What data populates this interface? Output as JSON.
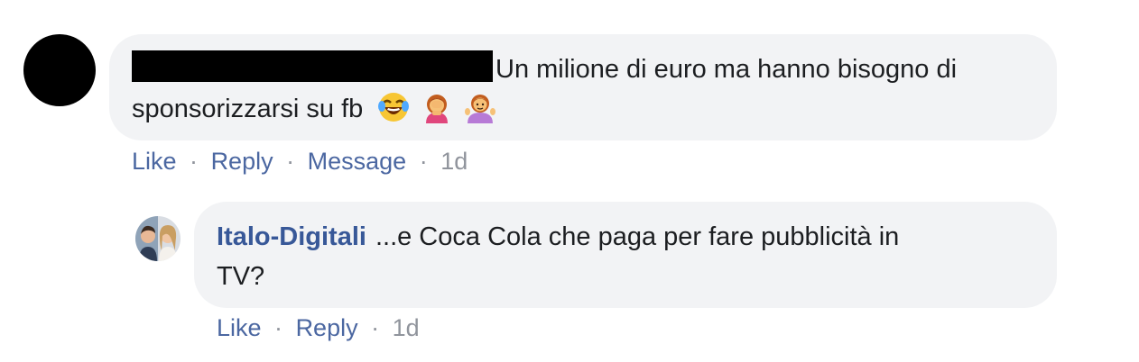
{
  "comment": {
    "text_line1": "Un milione di euro ma hanno bisogno di",
    "text_line2": "sponsorizzarsi su fb",
    "emojis": [
      "laughing-tears-emoji",
      "woman-facepalming-emoji",
      "woman-shrugging-emoji"
    ],
    "actions": {
      "like": "Like",
      "reply": "Reply",
      "message": "Message",
      "separator": "·",
      "time": "1d"
    }
  },
  "reply": {
    "author": "Italo-Digitali",
    "text_line1": "...e Coca Cola che paga per fare pubblicità in",
    "text_line2": "TV?",
    "actions": {
      "like": "Like",
      "reply": "Reply",
      "separator": "·",
      "time": "1d"
    }
  },
  "colors": {
    "link_blue": "#385898",
    "action_blue": "#4b67a1",
    "meta_gray": "#90949c",
    "bubble_bg": "#f2f3f5"
  }
}
